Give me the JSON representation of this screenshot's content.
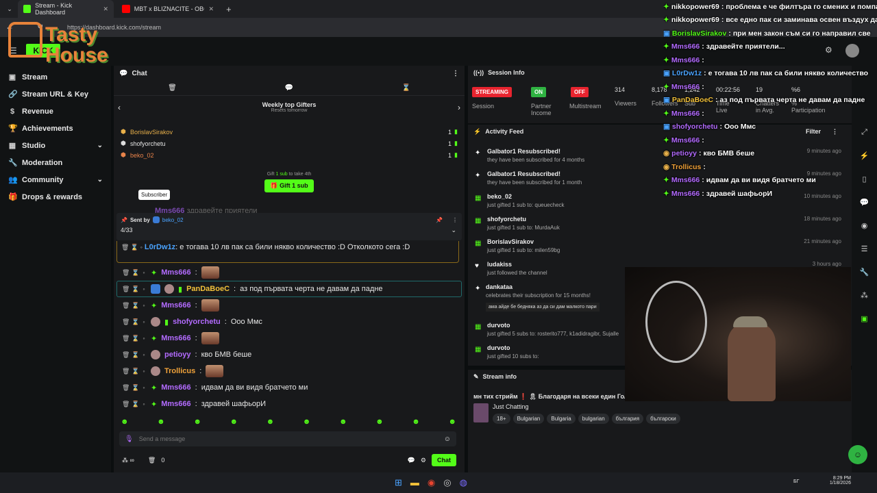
{
  "browser": {
    "tabs": [
      {
        "title": "Stream - Kick Dashboard",
        "active": true
      },
      {
        "title": "MBT x BLIZNACITE - OBOROTI",
        "active": false
      }
    ],
    "url": "https://dashboard.kick.com/stream",
    "new_tab": "+"
  },
  "logo": {
    "text": "Tasty House"
  },
  "sidebar": {
    "items": [
      {
        "label": "Stream",
        "icon": "video-icon"
      },
      {
        "label": "Stream URL & Key",
        "icon": "link-icon"
      },
      {
        "label": "Revenue",
        "icon": "dollar-icon"
      },
      {
        "label": "Achievements",
        "icon": "trophy-icon"
      },
      {
        "label": "Studio",
        "icon": "studio-icon",
        "expandable": true
      },
      {
        "label": "Moderation",
        "icon": "wrench-icon"
      },
      {
        "label": "Community",
        "icon": "people-icon",
        "expandable": true
      },
      {
        "label": "Drops & rewards",
        "icon": "gift-icon"
      }
    ]
  },
  "chat": {
    "title": "Chat",
    "gifters_title": "Weekly top Gifters",
    "gifters_sub": "Resets tomorrow",
    "gifters": [
      {
        "name": "BorislavSirakov",
        "count": "1",
        "color": "#e8b04a"
      },
      {
        "name": "shofyorchetu",
        "count": "1",
        "color": "#e6e6e6"
      },
      {
        "name": "beko_02",
        "count": "1",
        "color": "#e8834a"
      }
    ],
    "gift_hint_prefix": "Gift",
    "gift_hint_sub": "1 sub",
    "gift_hint_suffix": "to take 4th",
    "gift_button": "Gift 1 sub",
    "tooltip": "Subscriber",
    "pinned": {
      "sent_by_label": "Sent by",
      "sender": "beko_02",
      "counter": "4/33"
    },
    "truncated_msg": {
      "user": "Mms666",
      "text": "здравейте приятели"
    },
    "lordw_msg": {
      "user": "L0rDw1z",
      "text": "е тогава 10 лв пак са били някво количество :D Отколкото сега :D"
    },
    "messages": [
      {
        "user": "Mms666",
        "color": "#b36bff",
        "text": "",
        "emote": true
      },
      {
        "user": "PanDaBoeC",
        "color": "#f2c13a",
        "text": "аз под първата черта не давам да падне",
        "emote": false,
        "highlight": true
      },
      {
        "user": "Mms666",
        "color": "#b36bff",
        "text": "",
        "emote": true
      },
      {
        "user": "shofyorchetu",
        "color": "#b36bff",
        "text": "Ооо Ммс",
        "emote": false
      },
      {
        "user": "Mms666",
        "color": "#b36bff",
        "text": "",
        "emote": true
      },
      {
        "user": "petioyy",
        "color": "#b36bff",
        "text": "кво БМВ беше",
        "emote": false
      },
      {
        "user": "Trollicus",
        "color": "#f2a33a",
        "text": "",
        "emote": true
      },
      {
        "user": "Mms666",
        "color": "#b36bff",
        "text": "идвам да ви видя братчето ми",
        "emote": false
      },
      {
        "user": "Mms666",
        "color": "#b36bff",
        "text": "здравей шафьорИ",
        "emote": false
      }
    ],
    "input_placeholder": "Send a message",
    "viewer_count": "0",
    "send_button": "Chat"
  },
  "session": {
    "title": "Session Info",
    "stats": [
      {
        "pill": "STREAMING",
        "pill_color": "#e8242f",
        "label": "Session"
      },
      {
        "pill": "ON",
        "pill_color": "#2fb342",
        "label": "Partner Income"
      },
      {
        "pill": "OFF",
        "pill_color": "#e8242f",
        "label": "Multistream"
      },
      {
        "value": "314",
        "label": "Viewers"
      },
      {
        "value": "8,178",
        "label": "Followers"
      },
      {
        "value": "1,242",
        "label": "Sub"
      },
      {
        "value": "00:22:56",
        "label": "Time Live"
      },
      {
        "value": "19",
        "label": "Chatters in Avg."
      },
      {
        "value": "%6",
        "label": "% Participation"
      }
    ]
  },
  "activity": {
    "title": "Activity Feed",
    "filter": "Filter",
    "items": [
      {
        "icon": "star-icon",
        "title": "Galbator1 Resubscribed!",
        "detail": "they have been subscribed for 4 months",
        "time": "9 minutes ago"
      },
      {
        "icon": "star-icon",
        "title": "Galbator1 Resubscribed!",
        "detail": "they have been subscribed for 1 month",
        "time": "9 minutes ago"
      },
      {
        "icon": "gift-icon",
        "title": "beko_02",
        "detail": "just gifted 1 sub to: queuecheck",
        "time": "10 minutes ago"
      },
      {
        "icon": "gift-icon",
        "title": "shofyorchetu",
        "detail": "just gifted 1 sub to: MurdaAuk",
        "time": "18 minutes ago"
      },
      {
        "icon": "gift-icon",
        "title": "BorislavSirakov",
        "detail": "just gifted 1 sub to: milen59bg",
        "time": "21 minutes ago"
      },
      {
        "icon": "heart-icon",
        "title": "ludakiss",
        "detail": "just followed the channel",
        "time": "3 hours ago"
      },
      {
        "icon": "star-icon",
        "title": "dankataa",
        "detail": "celebrates their subscription for 15 months!",
        "time": ""
      },
      {
        "icon": "gift-icon",
        "title": "durvoto",
        "detail": "just gifted 5 subs to: rosterito777, k1adidragibr, Sujalle",
        "time": ""
      },
      {
        "icon": "gift-icon",
        "title": "durvoto",
        "detail": "just gifted 10 subs to:",
        "time": ""
      }
    ],
    "quote": "ама айде бе бедняка аз да си дам малкото пари"
  },
  "stream_info": {
    "title": "Stream info",
    "headline": "мн тих стрийм ❗ 🎗 Благодаря на всеки един Голо",
    "category": "Just Chatting",
    "tags": [
      "18+",
      "Bulgarian",
      "Bulgaria",
      "bulgarian",
      "българия",
      "български"
    ]
  },
  "overlay_chat": [
    {
      "user": "nikkopower69",
      "text": "проблема е че филтъра го смених и помпат"
    },
    {
      "user": "nikkopower69",
      "text": "все едно пак си заминава освен въздух да"
    },
    {
      "user": "BorislavSirakov",
      "text": "при мен закон съм си го направил све"
    },
    {
      "user": "Mms666",
      "text": "здравейте приятели..."
    },
    {
      "user": "Mms666",
      "text": ""
    },
    {
      "user": "L0rDw1z",
      "text": "е тогава 10 лв пак са били някво количество"
    },
    {
      "user": "Mms666",
      "text": ""
    },
    {
      "user": "PanDaBoeC",
      "text": "аз под първата черта не давам да падне"
    },
    {
      "user": "Mms666",
      "text": ""
    },
    {
      "user": "shofyorchetu",
      "text": "Ооо Ммс"
    },
    {
      "user": "Mms666",
      "text": ""
    },
    {
      "user": "petioyy",
      "text": "кво БМВ беше"
    },
    {
      "user": "Trollicus",
      "text": ""
    },
    {
      "user": "Mms666",
      "text": "идвам да ви видя братчето ми"
    },
    {
      "user": "Mms666",
      "text": "здравей шафьорИ"
    }
  ],
  "taskbar": {
    "time": "8:29 PM",
    "date": "1/18/2026",
    "lang": "БГ"
  },
  "colors": {
    "accent": "#53fc18",
    "bg": "#0b0e0f",
    "panel": "#18191b"
  }
}
